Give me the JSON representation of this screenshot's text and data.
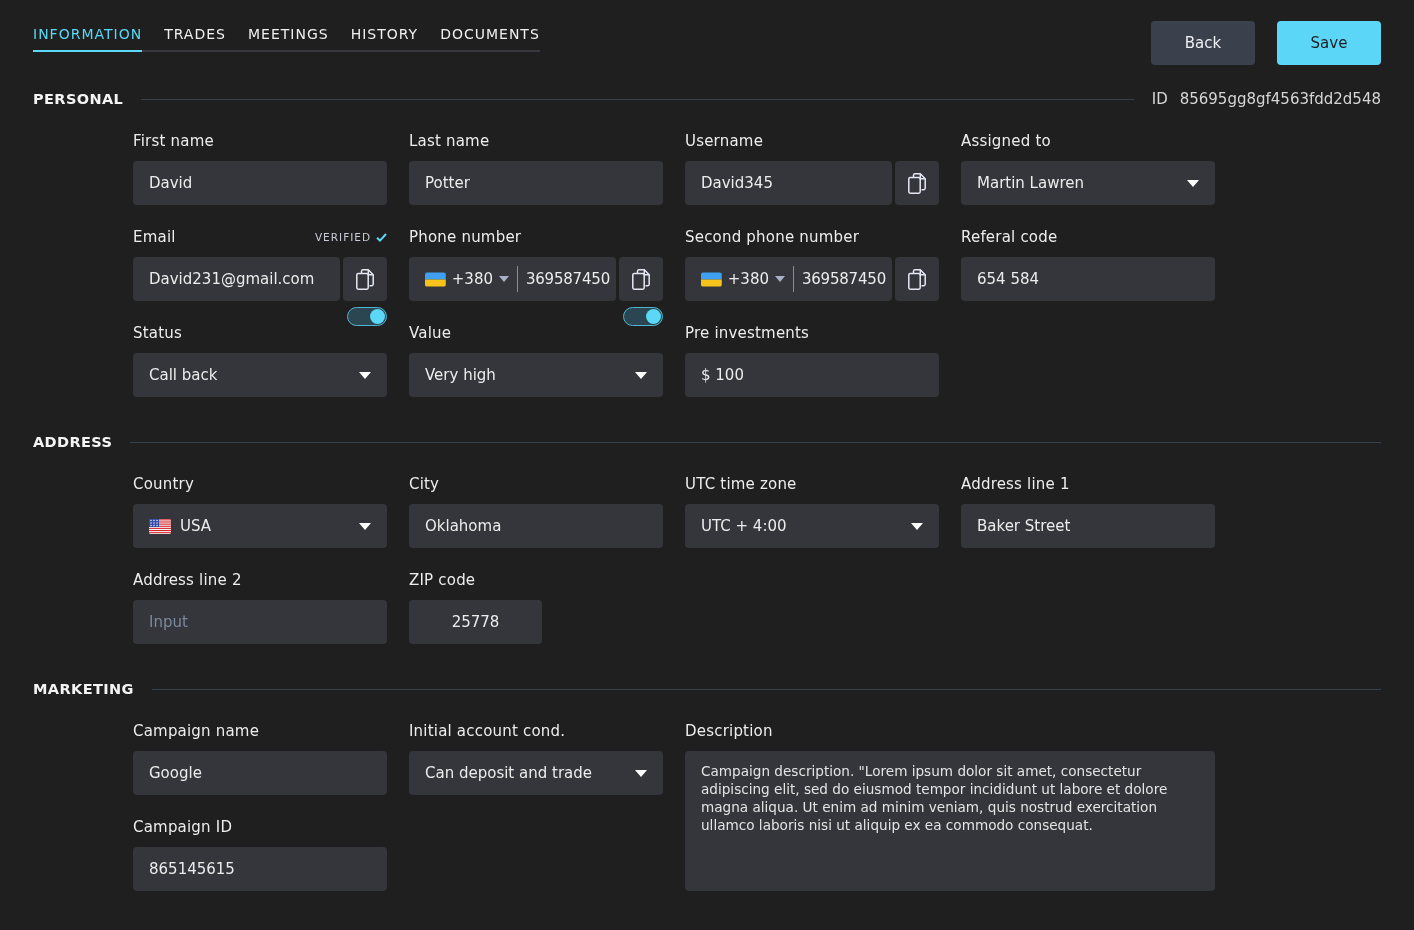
{
  "tabs": [
    {
      "label": "INFORMATION",
      "selected": true
    },
    {
      "label": "TRADES",
      "selected": false
    },
    {
      "label": "MEETINGS",
      "selected": false
    },
    {
      "label": "HISTORY",
      "selected": false
    },
    {
      "label": "DOCUMENTS",
      "selected": false
    }
  ],
  "actions": [
    {
      "label": "Back",
      "kind": "back"
    },
    {
      "label": "Save",
      "kind": "save"
    }
  ],
  "sections": [
    {
      "title": "PERSONAL",
      "id": {
        "label": "ID",
        "value": "85695gg8gf4563fdd2d548"
      },
      "fields": [
        {
          "kind": "text",
          "label": "First name",
          "value": "David"
        },
        {
          "kind": "text",
          "label": "Last name",
          "value": "Potter"
        },
        {
          "kind": "copy",
          "label": "Username",
          "value": "David345"
        },
        {
          "kind": "select",
          "label": "Assigned to",
          "value": "Martin Lawren"
        },
        {
          "kind": "copy",
          "label": "Email",
          "badge": "VERIFIED",
          "value": "David231@gmail.com",
          "switch": {
            "on": true
          }
        },
        {
          "kind": "phone",
          "label": "Phone number",
          "code": "+380",
          "value": "369587450",
          "switch": {
            "on": true
          }
        },
        {
          "kind": "phone",
          "label": "Second phone number",
          "code": "+380",
          "value": "369587450"
        },
        {
          "kind": "text",
          "label": "Referal code",
          "value": "654 584"
        },
        {
          "kind": "select",
          "label": "Status",
          "value": "Call back"
        },
        {
          "kind": "select",
          "label": "Value",
          "value": "Very high"
        },
        {
          "kind": "text",
          "label": "Pre investments",
          "value": "$ 100"
        }
      ]
    },
    {
      "title": "ADDRESS",
      "fields": [
        {
          "kind": "country",
          "label": "Country",
          "value": "USA"
        },
        {
          "kind": "text",
          "label": "City",
          "value": "Oklahoma"
        },
        {
          "kind": "select",
          "label": "UTC time zone",
          "value": "UTC + 4:00"
        },
        {
          "kind": "text",
          "label": "Address line 1",
          "value": "Baker Street"
        },
        {
          "kind": "text",
          "label": "Address line 2",
          "placeholder": "Input"
        },
        {
          "kind": "short",
          "label": "ZIP code",
          "value": "25778"
        }
      ]
    },
    {
      "title": "MARKETING",
      "fields": [
        {
          "kind": "text",
          "label": "Campaign name",
          "value": "Google"
        },
        {
          "kind": "select",
          "label": "Initial account cond.",
          "value": "Can deposit and trade"
        },
        {
          "kind": "textarea",
          "label": "Description",
          "value": "Campaign description. \"Lorem ipsum dolor sit amet, consectetur adipiscing elit, sed do eiusmod tempor incididunt ut labore et dolore magna aliqua. Ut enim ad minim veniam, quis nostrud exercitation ullamco laboris nisi ut aliquip ex ea commodo consequat."
        },
        {
          "kind": "text",
          "label": "Campaign ID",
          "value": "865145615"
        }
      ]
    }
  ]
}
